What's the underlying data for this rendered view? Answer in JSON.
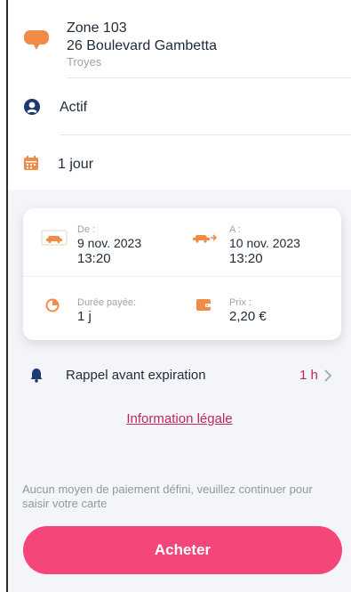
{
  "zone": {
    "title": "Zone 103",
    "address": "26 Boulevard Gambetta",
    "city": "Troyes"
  },
  "status": {
    "label": "Actif"
  },
  "duration": {
    "label": "1 jour"
  },
  "ticket": {
    "start_label": "De :",
    "start_date": "9 nov. 2023",
    "start_time": "13:20",
    "end_label": "A :",
    "end_date": "10 nov. 2023",
    "end_time": "13:20",
    "paid_label": "Durée payée:",
    "paid_value": "1 j",
    "price_label": "Prix :",
    "price_value": "2,20 €"
  },
  "reminder": {
    "label": "Rappel avant expiration",
    "value": "1 h"
  },
  "legal_link": "Information légale",
  "notice": "Aucun moyen de paiement défini, veuillez continuer pour saisir votre carte",
  "buy_button": "Acheter",
  "colors": {
    "accent": "#f28a48",
    "primary": "#f44678",
    "navy": "#1f3a6e",
    "link": "#c2255c"
  }
}
